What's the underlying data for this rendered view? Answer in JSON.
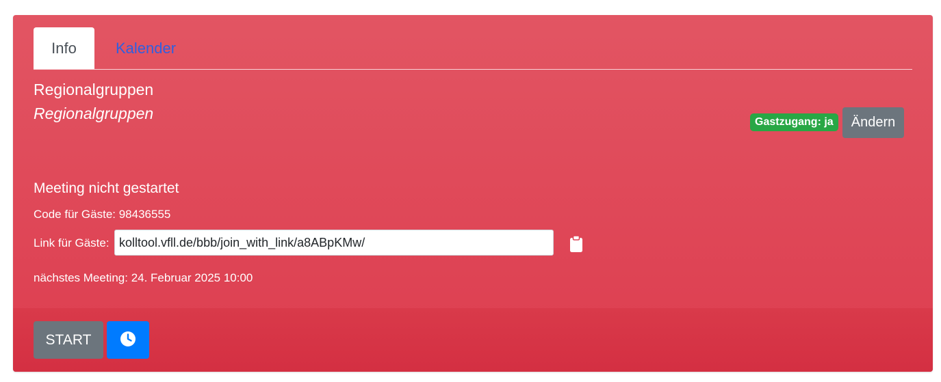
{
  "tabs": [
    {
      "label": "Info",
      "active": true
    },
    {
      "label": "Kalender",
      "active": false
    }
  ],
  "room": {
    "title": "Regionalgruppen",
    "subtitle": "Regionalgruppen"
  },
  "guest_access": {
    "badge": "Gastzugang: ja",
    "change_label": "Ändern"
  },
  "meeting": {
    "status": "Meeting nicht gestartet",
    "code_line": "Code für Gäste: 98436555",
    "link_label": "Link für Gäste:",
    "link_value": "kolltool.vfll.de/bbb/join_with_link/a8ABpKMw/",
    "next_meeting": "nächstes Meeting: 24. Februar 2025 10:00"
  },
  "actions": {
    "start_label": "START",
    "schedule_icon": "clock-icon",
    "copy_icon": "clipboard-icon"
  },
  "colors": {
    "card": "#dd3d4f",
    "badge": "#28a745",
    "secondary_button": "#6c757d",
    "primary_button": "#007bff",
    "tab_link": "#2f5fe0"
  }
}
